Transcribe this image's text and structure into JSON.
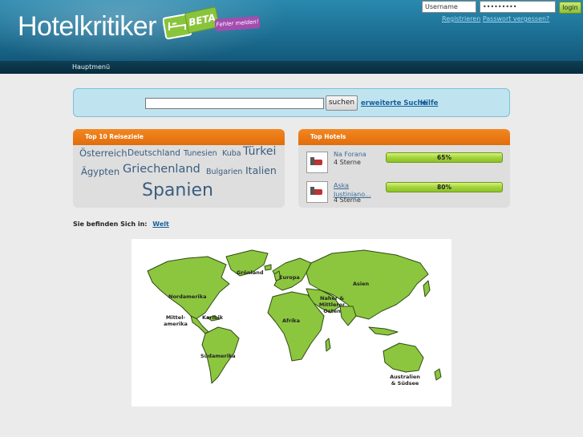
{
  "header": {
    "logo_text": "Hotelkritiker",
    "beta_label": "BETA",
    "report_link": "Fehler melden!"
  },
  "login": {
    "username_value": "Username",
    "password_value": "•••••••••",
    "button_label": "login",
    "register_link": "Registrieren",
    "forgot_link": "Passwort vergessen?"
  },
  "nav": {
    "main_menu": "Hauptmenü"
  },
  "search": {
    "value": "",
    "button_label": "suchen",
    "advanced_link": "erweiterte Suche",
    "help_link": "Hilfe"
  },
  "top_destinations": {
    "title": "Top 10 Reiseziele",
    "tags": [
      {
        "name": "Österreich"
      },
      {
        "name": "Deutschland"
      },
      {
        "name": "Tunesien"
      },
      {
        "name": "Kuba"
      },
      {
        "name": "Türkei"
      },
      {
        "name": "Ägypten"
      },
      {
        "name": "Griechenland"
      },
      {
        "name": "Bulgarien"
      },
      {
        "name": "Italien"
      },
      {
        "name": "Spanien"
      }
    ]
  },
  "top_hotels": {
    "title": "Top Hotels",
    "hotels": [
      {
        "name": "Na Forana",
        "stars": "4 Sterne",
        "rating": "65%",
        "rating_value": 0.65
      },
      {
        "name": "Aska Justiniano...",
        "stars": "4 Sterne",
        "rating": "80%",
        "rating_value": 0.8
      }
    ]
  },
  "location": {
    "label": "Sie befinden Sich in:",
    "crumb": "Welt"
  },
  "map": {
    "land_color": "#8cc63f",
    "outline_color": "#2f4a14",
    "regions": [
      {
        "name": "Grönland"
      },
      {
        "name": "Europa"
      },
      {
        "name": "Asien"
      },
      {
        "name": "Nordamerika"
      },
      {
        "name": "Naher & Mittlerer Osten"
      },
      {
        "name": "Mittel-amerika"
      },
      {
        "name": "Karibik"
      },
      {
        "name": "Afrika"
      },
      {
        "name": "Südamerika"
      },
      {
        "name": "Australien & Südsee"
      }
    ]
  }
}
